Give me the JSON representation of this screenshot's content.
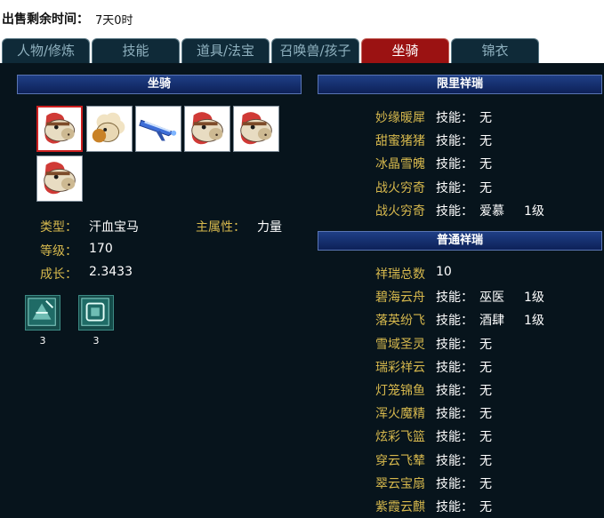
{
  "sale": {
    "label": "出售剩余时间：",
    "value": "7天0时"
  },
  "tabs": [
    {
      "label": "人物/修炼",
      "active": false
    },
    {
      "label": "技能",
      "active": false
    },
    {
      "label": "道具/法宝",
      "active": false
    },
    {
      "label": "召唤兽/孩子",
      "active": false
    },
    {
      "label": "坐骑",
      "active": true
    },
    {
      "label": "锦衣",
      "active": false
    }
  ],
  "left": {
    "header": "坐骑",
    "mounts": [
      {
        "kind": "horse",
        "selected": true
      },
      {
        "kind": "sheep",
        "selected": false
      },
      {
        "kind": "blade",
        "selected": false
      },
      {
        "kind": "horse",
        "selected": false
      },
      {
        "kind": "horse",
        "selected": false
      },
      {
        "kind": "horse",
        "selected": false
      }
    ],
    "info": {
      "type_label": "类型：",
      "type_value": "汗血宝马",
      "attr_label": "主属性：",
      "attr_value": "力量",
      "level_label": "等级：",
      "level_value": "170",
      "growth_label": "成长：",
      "growth_value": "2.3433"
    },
    "skills": [
      {
        "icon": "skill-rune-icon",
        "count": "3"
      },
      {
        "icon": "skill-frame-icon",
        "count": "3"
      }
    ]
  },
  "limited": {
    "header": "限里祥瑞",
    "rows": [
      {
        "name": "妙缘暖犀",
        "skill_label": "技能：",
        "skill": "无",
        "level": ""
      },
      {
        "name": "甜蜜猪猪",
        "skill_label": "技能：",
        "skill": "无",
        "level": ""
      },
      {
        "name": "冰晶雪魄",
        "skill_label": "技能：",
        "skill": "无",
        "level": ""
      },
      {
        "name": "战火穷奇",
        "skill_label": "技能：",
        "skill": "无",
        "level": ""
      },
      {
        "name": "战火穷奇",
        "skill_label": "技能：",
        "skill": "爱慕",
        "level": "1级"
      }
    ]
  },
  "normal": {
    "header": "普通祥瑞",
    "total_label": "祥瑞总数",
    "total_value": "10",
    "rows": [
      {
        "name": "碧海云舟",
        "skill_label": "技能：",
        "skill": "巫医",
        "level": "1级"
      },
      {
        "name": "落英纷飞",
        "skill_label": "技能：",
        "skill": "酒肆",
        "level": "1级"
      },
      {
        "name": "雪域圣灵",
        "skill_label": "技能：",
        "skill": "无",
        "level": ""
      },
      {
        "name": "瑞彩祥云",
        "skill_label": "技能：",
        "skill": "无",
        "level": ""
      },
      {
        "name": "灯笼锦鱼",
        "skill_label": "技能：",
        "skill": "无",
        "level": ""
      },
      {
        "name": "浑火魔精",
        "skill_label": "技能：",
        "skill": "无",
        "level": ""
      },
      {
        "name": "炫彩飞篮",
        "skill_label": "技能：",
        "skill": "无",
        "level": ""
      },
      {
        "name": "穿云飞辇",
        "skill_label": "技能：",
        "skill": "无",
        "level": ""
      },
      {
        "name": "翠云宝扇",
        "skill_label": "技能：",
        "skill": "无",
        "level": ""
      },
      {
        "name": "紫霞云麒",
        "skill_label": "技能：",
        "skill": "无",
        "level": ""
      }
    ]
  },
  "colors": {
    "panel_bg": "#07141c",
    "label_gold": "#d6b84d",
    "value_white": "#ffffff",
    "active_tab": "#9b1212",
    "header_blue": "#1f3f86"
  }
}
